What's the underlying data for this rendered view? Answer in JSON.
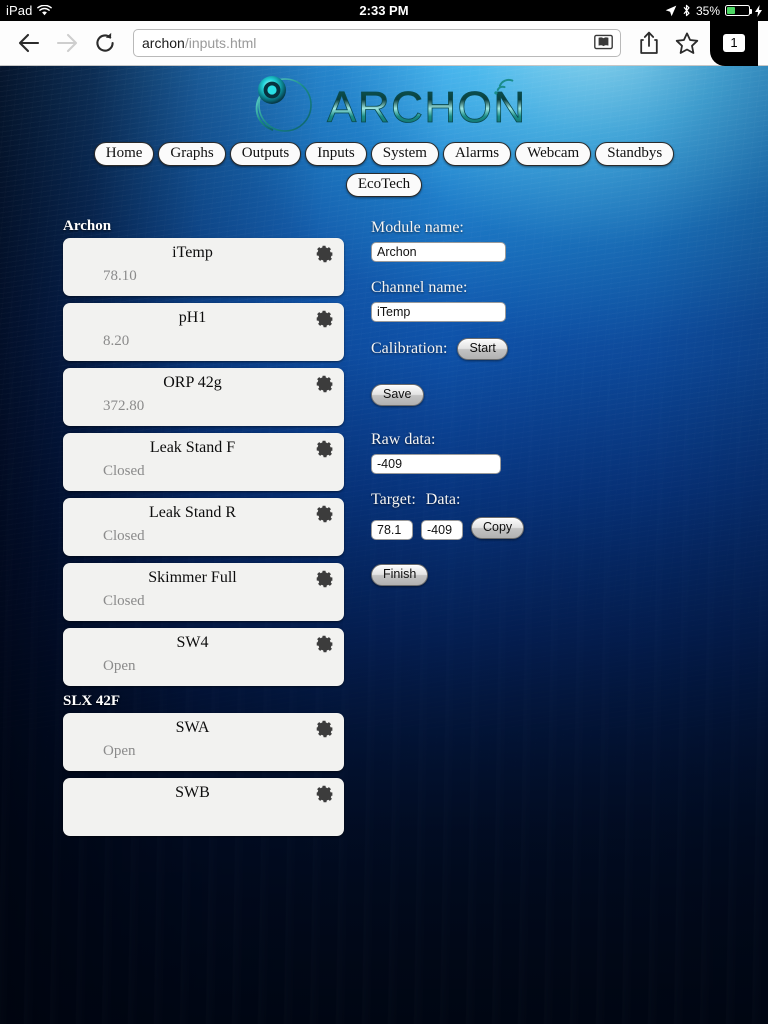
{
  "status_bar": {
    "device": "iPad",
    "wifi_icon": "wifi-icon",
    "time": "2:33 PM",
    "location_icon": "location-arrow-icon",
    "bluetooth_icon": "bluetooth-icon",
    "battery_percent": "35%",
    "battery_level": 35,
    "charging_icon": "lightning-bolt-icon"
  },
  "browser": {
    "back_icon": "back-arrow-icon",
    "forward_icon": "forward-arrow-icon",
    "reload_icon": "reload-icon",
    "url_host": "archon",
    "url_path": "/inputs.html",
    "reader_icon": "reader-view-icon",
    "share_icon": "share-icon",
    "bookmark_icon": "bookmark-star-icon",
    "tab_count": "1"
  },
  "logo": {
    "brand": "ARCHON",
    "mark_icon": "archon-circle-icon",
    "signal_icon": "wireless-signal-icon",
    "teal": "#1e8c86",
    "cyan": "#25d8d0"
  },
  "nav": {
    "row1": [
      "Home",
      "Graphs",
      "Outputs",
      "Inputs",
      "System",
      "Alarms",
      "Webcam",
      "Standbys"
    ],
    "row2": [
      "EcoTech"
    ]
  },
  "channels": {
    "groups": [
      {
        "title": "Archon",
        "items": [
          {
            "name": "iTemp",
            "value": "78.10"
          },
          {
            "name": "pH1",
            "value": "8.20"
          },
          {
            "name": "ORP 42g",
            "value": "372.80"
          },
          {
            "name": "Leak Stand F",
            "value": "Closed"
          },
          {
            "name": "Leak Stand R",
            "value": "Closed"
          },
          {
            "name": "Skimmer Full",
            "value": "Closed"
          },
          {
            "name": "SW4",
            "value": "Open"
          }
        ]
      },
      {
        "title": "SLX 42F",
        "items": [
          {
            "name": "SWA",
            "value": "Open"
          },
          {
            "name": "SWB",
            "value": ""
          }
        ]
      }
    ],
    "gear_icon": "gear-icon"
  },
  "form": {
    "module_label": "Module name:",
    "module_value": "Archon",
    "channel_label": "Channel name:",
    "channel_value": "iTemp",
    "calibration_label": "Calibration:",
    "start_label": "Start",
    "save_label": "Save",
    "raw_label": "Raw data:",
    "raw_value": "-409",
    "target_label": "Target:",
    "data_label": "Data:",
    "target_value": "78.1",
    "data_value": "-409",
    "copy_label": "Copy",
    "finish_label": "Finish"
  }
}
